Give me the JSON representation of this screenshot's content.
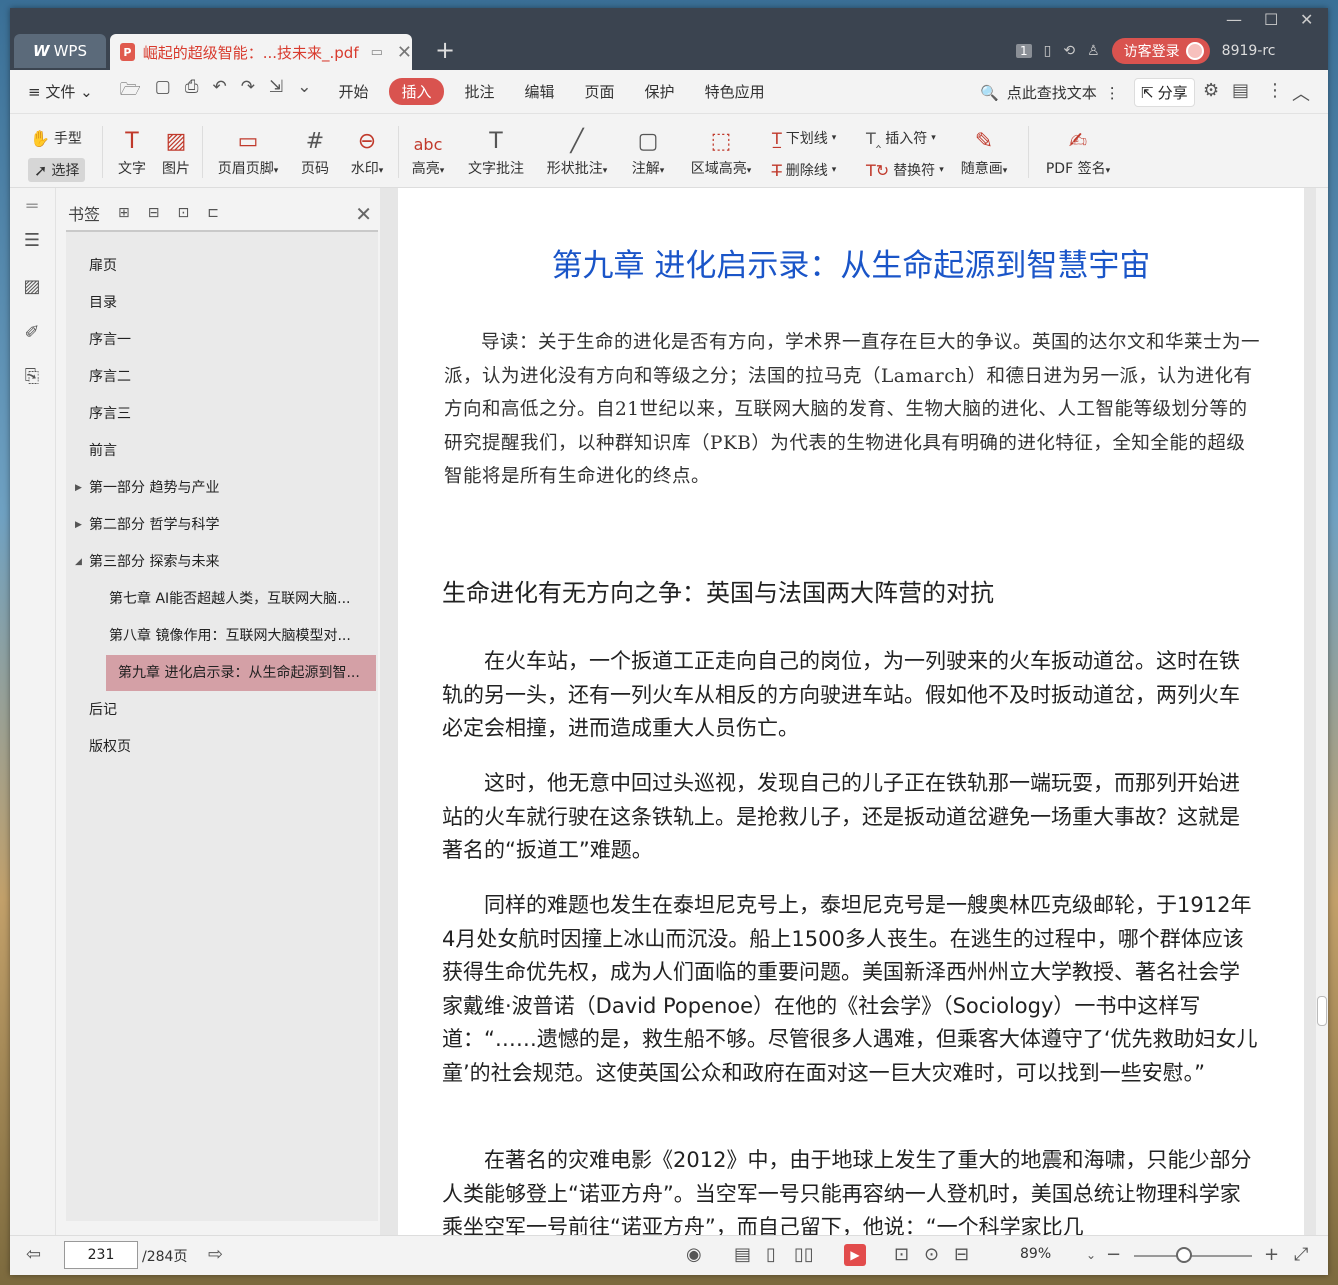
{
  "titlebar": {
    "app_tab": "WPS",
    "doc_tab": "崛起的超级智能：...技未来_.pdf",
    "page_badge": "1",
    "guest_login": "访客登录",
    "user": "8919-rc"
  },
  "menu": {
    "file": "文件",
    "items": [
      "开始",
      "插入",
      "批注",
      "编辑",
      "页面",
      "保护",
      "特色应用"
    ],
    "active": "插入",
    "search": "点此查找文本",
    "share": "分享"
  },
  "ribbon": {
    "hand": "手型",
    "select": "选择",
    "text": "文字",
    "image": "图片",
    "header_footer": "页眉页脚",
    "page_num": "页码",
    "watermark": "水印",
    "highlight": "高亮",
    "text_note": "文字批注",
    "shape_note": "形状批注",
    "annotate": "注解",
    "area_highlight": "区域高亮",
    "underline": "下划线",
    "strikethrough": "删除线",
    "insert_mark": "插入符",
    "replace_mark": "替换符",
    "freehand": "随意画",
    "pdf_sign": "PDF 签名"
  },
  "bookmarks": {
    "title": "书签",
    "items": [
      "扉页",
      "目录",
      "序言一",
      "序言二",
      "序言三",
      "前言",
      "第一部分 趋势与产业",
      "第二部分 哲学与科学",
      "第三部分 探索与未来",
      "第七章 AI能否超越人类，互联网大脑...",
      "第八章 镜像作用：互联网大脑模型对...",
      "第九章 进化启示录：从生命起源到智...",
      "后记",
      "版权页"
    ]
  },
  "doc": {
    "chapter_title": "第九章 进化启示录：从生命起源到智慧宇宙",
    "guide": "导读：关于生命的进化是否有方向，学术界一直存在巨大的争议。英国的达尔文和华莱士为一派，认为进化没有方向和等级之分；法国的拉马克（Lamarch）和德日进为另一派，认为进化有方向和高低之分。自21世纪以来，互联网大脑的发育、生物大脑的进化、人工智能等级划分等的研究提醒我们，以种群知识库（PKB）为代表的生物进化具有明确的进化特征，全知全能的超级智能将是所有生命进化的终点。",
    "section_title": "生命进化有无方向之争：英国与法国两大阵营的对抗",
    "p1": "在火车站，一个扳道工正走向自己的岗位，为一列驶来的火车扳动道岔。这时在铁轨的另一头，还有一列火车从相反的方向驶进车站。假如他不及时扳动道岔，两列火车必定会相撞，进而造成重大人员伤亡。",
    "p2": "这时，他无意中回过头巡视，发现自己的儿子正在铁轨那一端玩耍，而那列开始进站的火车就行驶在这条铁轨上。是抢救儿子，还是扳动道岔避免一场重大事故？这就是著名的“扳道工”难题。",
    "p3": "同样的难题也发生在泰坦尼克号上，泰坦尼克号是一艘奥林匹克级邮轮，于1912年4月处女航时因撞上冰山而沉没。船上1500多人丧生。在逃生的过程中，哪个群体应该获得生命优先权，成为人们面临的重要问题。美国新泽西州州立大学教授、著名社会学家戴维·波普诺（David Popenoe）在他的《社会学》（Sociology）一书中这样写道：“……遗憾的是，救生船不够。尽管很多人遇难，但乘客大体遵守了‘优先救助妇女儿童’的社会规范。这使英国公众和政府在面对这一巨大灾难时，可以找到一些安慰。”",
    "p4": "在著名的灾难电影《2012》中，由于地球上发生了重大的地震和海啸，只能少部分人类能够登上“诺亚方舟”。当空军一号只能再容纳一人登机时，美国总统让物理科学家乘坐空军一号前往“诺亚方舟”，而自己留下，他说：“一个科学家比几"
  },
  "status": {
    "current_page": "231",
    "total_pages": "/284页",
    "zoom": "89%"
  }
}
